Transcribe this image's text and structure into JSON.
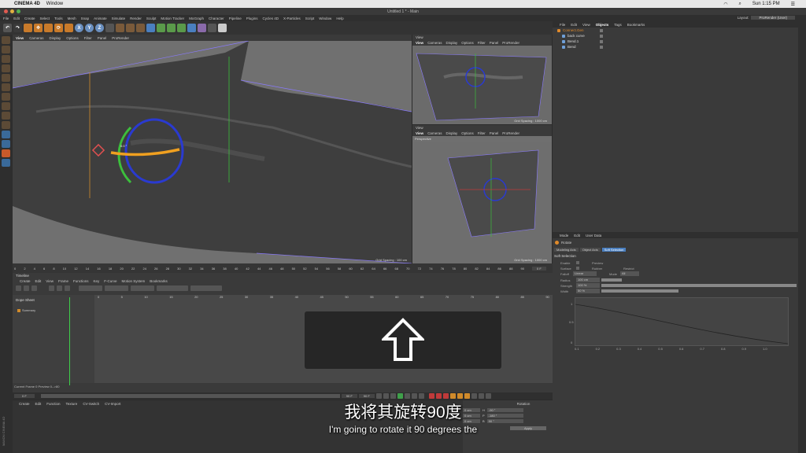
{
  "macbar": {
    "app": "CINEMA 4D",
    "menu": "Window",
    "clock": "Sun 1:15 PM"
  },
  "title": "Untitled 1 * - Main",
  "menu": [
    "File",
    "Edit",
    "Create",
    "Select",
    "Tools",
    "Mesh",
    "Snap",
    "Animate",
    "Simulate",
    "Render",
    "Sculpt",
    "Motion Tracker",
    "MoGraph",
    "Character",
    "Pipeline",
    "Plugins",
    "Cycles 4D",
    "X-Particles",
    "Script",
    "Window",
    "Help"
  ],
  "layout": {
    "label": "Layout:",
    "value": "ProRender (User)"
  },
  "toolbar": {
    "x": "X",
    "y": "Y",
    "z": "Z"
  },
  "viewport_main": {
    "tabs": [
      "View",
      "Cameras",
      "Display",
      "Options",
      "Filter",
      "Panel",
      "ProRender"
    ],
    "label": "Perspective",
    "grid": "Grid Spacing : 100 cm",
    "angle": "0.0 °"
  },
  "viewport_tr": {
    "title": "View",
    "tabs": [
      "View",
      "Cameras",
      "Display",
      "Options",
      "Filter",
      "Panel",
      "ProRender"
    ],
    "grid": "Grid Spacing : 1000 cm"
  },
  "viewport_br": {
    "title": "View",
    "tabs": [
      "View",
      "Cameras",
      "Display",
      "Options",
      "Filter",
      "Panel",
      "ProRender"
    ],
    "label": "Perspective",
    "grid": "Grid Spacing : 1000 cm"
  },
  "objects": {
    "tabs": [
      "File",
      "Edit",
      "View",
      "Objects",
      "Tags",
      "Bookmarks"
    ],
    "items": [
      "Connect.Gen",
      "back curve",
      "Bend.1",
      "Bend"
    ]
  },
  "attributes": {
    "tabs": [
      "Mode",
      "Edit",
      "User Data"
    ],
    "object": "Rotate",
    "subtabs": [
      "Modeling Axis",
      "Object Axis",
      "Soft Selection"
    ],
    "section": "Soft Selection",
    "fields": [
      "Enable",
      "Surface",
      "Falloff",
      "Radius",
      "Strength",
      "Width"
    ],
    "fields2": [
      "Preview",
      "Rubber",
      "Restrict",
      "Mode"
    ],
    "falloff_value": "Linear",
    "mode_value": "All",
    "radius": "100 cm",
    "strength": "100 %",
    "width": "50 %",
    "graph_y": [
      "1",
      "0.5",
      "0"
    ],
    "graph_x": [
      "0.1",
      "0.2",
      "0.3",
      "0.4",
      "0.5",
      "0.6",
      "0.7",
      "0.8",
      "0.9",
      "1.0"
    ]
  },
  "ruler": [
    "0",
    "2",
    "4",
    "6",
    "8",
    "10",
    "12",
    "14",
    "16",
    "18",
    "20",
    "22",
    "24",
    "26",
    "28",
    "30",
    "32",
    "34",
    "36",
    "38",
    "40",
    "42",
    "44",
    "46",
    "48",
    "50",
    "52",
    "54",
    "56",
    "58",
    "60",
    "62",
    "64",
    "66",
    "68",
    "70",
    "72",
    "74",
    "76",
    "78",
    "80",
    "82",
    "84",
    "86",
    "88",
    "90"
  ],
  "ruler_end": "0 F",
  "timeline": {
    "title": "Timeline",
    "menu": [
      "Create",
      "Edit",
      "View",
      "Frame",
      "Functions",
      "Key",
      "F-Curve",
      "Motion System",
      "Bookmarks"
    ],
    "dope": "Dope Sheet",
    "summary": "Summary",
    "ticks": [
      "0",
      "5",
      "10",
      "15",
      "20",
      "25",
      "30",
      "35",
      "40",
      "45",
      "50",
      "55",
      "60",
      "65",
      "70",
      "75",
      "80",
      "85",
      "90"
    ],
    "current": "Current Frame  0   Preview  0-->80"
  },
  "playbar": {
    "start": "0 F",
    "end": "90 F",
    "end2": "90 F"
  },
  "material": {
    "menu": [
      "Create",
      "Edit",
      "Function",
      "Texture",
      "CV-Switch",
      "CV-Import"
    ],
    "rotation": "Rotation",
    "coords": [
      [
        "0 cm",
        "H",
        "-90 °"
      ],
      [
        "0 cm",
        "P",
        "-180 °"
      ],
      [
        "0 cm",
        "B",
        "90 °"
      ]
    ],
    "apply": "Apply"
  },
  "brand": "MAXON CINEMA 4D",
  "subtitle_cn": "我将其旋转90度",
  "subtitle_en": "I'm going to rotate it 90 degrees the"
}
